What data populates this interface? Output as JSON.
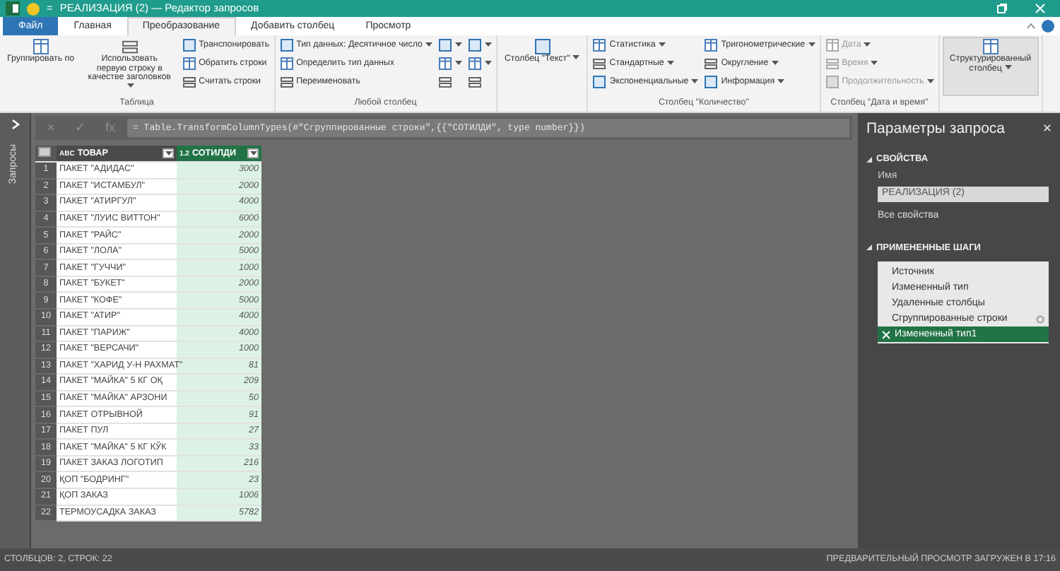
{
  "window": {
    "title": "РЕАЛИЗАЦИЯ (2) — Редактор запросов",
    "qat_glyph": "="
  },
  "tabs": [
    {
      "label": "Файл",
      "kind": "file",
      "selected": false
    },
    {
      "label": "Главная",
      "kind": "tab",
      "selected": false
    },
    {
      "label": "Преобразование",
      "kind": "tab",
      "selected": true
    },
    {
      "label": "Добавить столбец",
      "kind": "tab",
      "selected": false
    },
    {
      "label": "Просмотр",
      "kind": "tab",
      "selected": false
    }
  ],
  "ribbon": {
    "groups": [
      {
        "label": "Таблица",
        "disabled": false,
        "items": [
          {
            "kind": "large",
            "label": "Группировать по",
            "dropdown": false,
            "highlighted": false
          },
          {
            "kind": "large",
            "label": "Использовать первую строку в качестве заголовков",
            "dropdown": true,
            "highlighted": false
          },
          {
            "kind": "small",
            "label": "Транспонировать",
            "dropdown": false
          },
          {
            "kind": "small",
            "label": "Обратить строки",
            "dropdown": false
          },
          {
            "kind": "small",
            "label": "Считать строки",
            "dropdown": false
          }
        ]
      },
      {
        "label": "Любой столбец",
        "disabled": false,
        "items": [
          {
            "kind": "small",
            "label": "Тип данных: Десятичное число",
            "dropdown": true
          },
          {
            "kind": "small",
            "label": "Определить тип данных",
            "dropdown": false
          },
          {
            "kind": "small",
            "label": "Переименовать",
            "dropdown": false
          },
          {
            "kind": "icon",
            "dropdown": true
          },
          {
            "kind": "icon",
            "dropdown": true
          },
          {
            "kind": "icon",
            "dropdown": false
          },
          {
            "kind": "icon",
            "dropdown": true
          },
          {
            "kind": "icon",
            "dropdown": true
          },
          {
            "kind": "icon",
            "dropdown": false
          }
        ]
      },
      {
        "disabled": false,
        "items": [
          {
            "kind": "large",
            "label": "Столбец \"Текст\"",
            "dropdown": true,
            "highlighted": false
          }
        ]
      },
      {
        "label": "Столбец \"Количество\"",
        "disabled": false,
        "items": [
          {
            "kind": "small",
            "label": "Статистика",
            "dropdown": true
          },
          {
            "kind": "small",
            "label": "Стандартные",
            "dropdown": true
          },
          {
            "kind": "small",
            "label": "Экспоненциальные",
            "dropdown": true
          },
          {
            "kind": "small",
            "label": "Тригонометрические",
            "dropdown": true
          },
          {
            "kind": "small",
            "label": "Округление",
            "dropdown": true
          },
          {
            "kind": "small",
            "label": "Информация",
            "dropdown": true
          }
        ]
      },
      {
        "label": "Столбец \"Дата и время\"",
        "disabled": true,
        "items": [
          {
            "kind": "small",
            "label": "Дата",
            "dropdown": true
          },
          {
            "kind": "small",
            "label": "Время",
            "dropdown": true
          },
          {
            "kind": "small",
            "label": "Продолжительность",
            "dropdown": true
          }
        ]
      },
      {
        "disabled": false,
        "items": [
          {
            "kind": "large",
            "label": "Структурированный столбец",
            "dropdown": true,
            "highlighted": true
          }
        ]
      }
    ]
  },
  "queries_pane": {
    "label": "Запросы"
  },
  "formula_bar": {
    "buttons": [
      "×",
      "✓",
      "fx"
    ],
    "formula": "= Table.TransformColumnTypes(#\"Сгруппированные строки\",{{\"СОТИЛДИ\", type number}})"
  },
  "table": {
    "columns": [
      {
        "label": "ТОВАР",
        "type_label": "ABC",
        "selected": false
      },
      {
        "label": "СОТИЛДИ",
        "type_label": "1.2",
        "selected": true
      }
    ],
    "rows": [
      {
        "number": "1",
        "cells": [
          "ПАКЕТ \"АДИДАС\"",
          "3000"
        ]
      },
      {
        "number": "2",
        "cells": [
          "ПАКЕТ \"ИСТАМБУЛ\"",
          "2000"
        ]
      },
      {
        "number": "3",
        "cells": [
          "ПАКЕТ \"АТИРГУЛ\"",
          "4000"
        ]
      },
      {
        "number": "4",
        "cells": [
          "ПАКЕТ \"ЛУИС ВИТТОН\"",
          "6000"
        ]
      },
      {
        "number": "5",
        "cells": [
          "ПАКЕТ \"РАЙС\"",
          "2000"
        ]
      },
      {
        "number": "6",
        "cells": [
          "ПАКЕТ \"ЛОЛА\"",
          "5000"
        ]
      },
      {
        "number": "7",
        "cells": [
          "ПАКЕТ \"ГУЧЧИ\"",
          "1000"
        ]
      },
      {
        "number": "8",
        "cells": [
          "ПАКЕТ \"БУКЕТ\"",
          "2000"
        ]
      },
      {
        "number": "9",
        "cells": [
          "ПАКЕТ \"КОФЕ\"",
          "5000"
        ]
      },
      {
        "number": "10",
        "cells": [
          "ПАКЕТ \"АТИР\"",
          "4000"
        ]
      },
      {
        "number": "11",
        "cells": [
          "ПАКЕТ \"ПАРИЖ\"",
          "4000"
        ]
      },
      {
        "number": "12",
        "cells": [
          "ПАКЕТ \"ВЕРСАЧИ\"",
          "1000"
        ]
      },
      {
        "number": "13",
        "cells": [
          "ПАКЕТ \"ХАРИД У-Н РАХМАТ\"",
          "81"
        ]
      },
      {
        "number": "14",
        "cells": [
          "ПАКЕТ \"МАЙКА\" 5 КГ ОҚ",
          "209"
        ]
      },
      {
        "number": "15",
        "cells": [
          "ПАКЕТ \"МАЙКА\" АРЗОНИ",
          "50"
        ]
      },
      {
        "number": "16",
        "cells": [
          "ПАКЕТ ОТРЫВНОЙ",
          "91"
        ]
      },
      {
        "number": "17",
        "cells": [
          "ПАКЕТ ПУЛ",
          "27"
        ]
      },
      {
        "number": "18",
        "cells": [
          "ПАКЕТ \"МАЙКА\" 5 КГ КЎК",
          "33"
        ]
      },
      {
        "number": "19",
        "cells": [
          "ПАКЕТ ЗАКАЗ ЛОГОТИП",
          "216"
        ]
      },
      {
        "number": "20",
        "cells": [
          "ҚОП \"БОДРИНГ\"",
          "23"
        ]
      },
      {
        "number": "21",
        "cells": [
          "ҚОП ЗАКАЗ",
          "1006"
        ]
      },
      {
        "number": "22",
        "cells": [
          "ТЕРМОУСАДКА ЗАКАЗ",
          "5782"
        ]
      }
    ]
  },
  "settings_pane": {
    "title": "Параметры запроса",
    "close_glyph": "×",
    "properties": {
      "title": "СВОЙСТВА",
      "expanded": true,
      "name_label": "Имя",
      "name_value": "РЕАЛИЗАЦИЯ (2)",
      "link": "Все свойства"
    },
    "steps": {
      "title": "ПРИМЕНЕННЫЕ ШАГИ",
      "expanded": true,
      "items": [
        {
          "label": "Источник",
          "selected": false,
          "has_settings": false
        },
        {
          "label": "Измененный тип",
          "selected": false,
          "has_settings": false
        },
        {
          "label": "Удаленные столбцы",
          "selected": false,
          "has_settings": false
        },
        {
          "label": "Сгруппированные строки",
          "selected": false,
          "has_settings": true
        },
        {
          "label": "Измененный тип1",
          "selected": true,
          "has_settings": false
        }
      ]
    }
  },
  "status_bar": {
    "left": "СТОЛБЦОВ: 2, СТРОК: 22",
    "right": "ПРЕДВАРИТЕЛЬНЫЙ ПРОСМОТР ЗАГРУЖЕН В 17:16"
  }
}
